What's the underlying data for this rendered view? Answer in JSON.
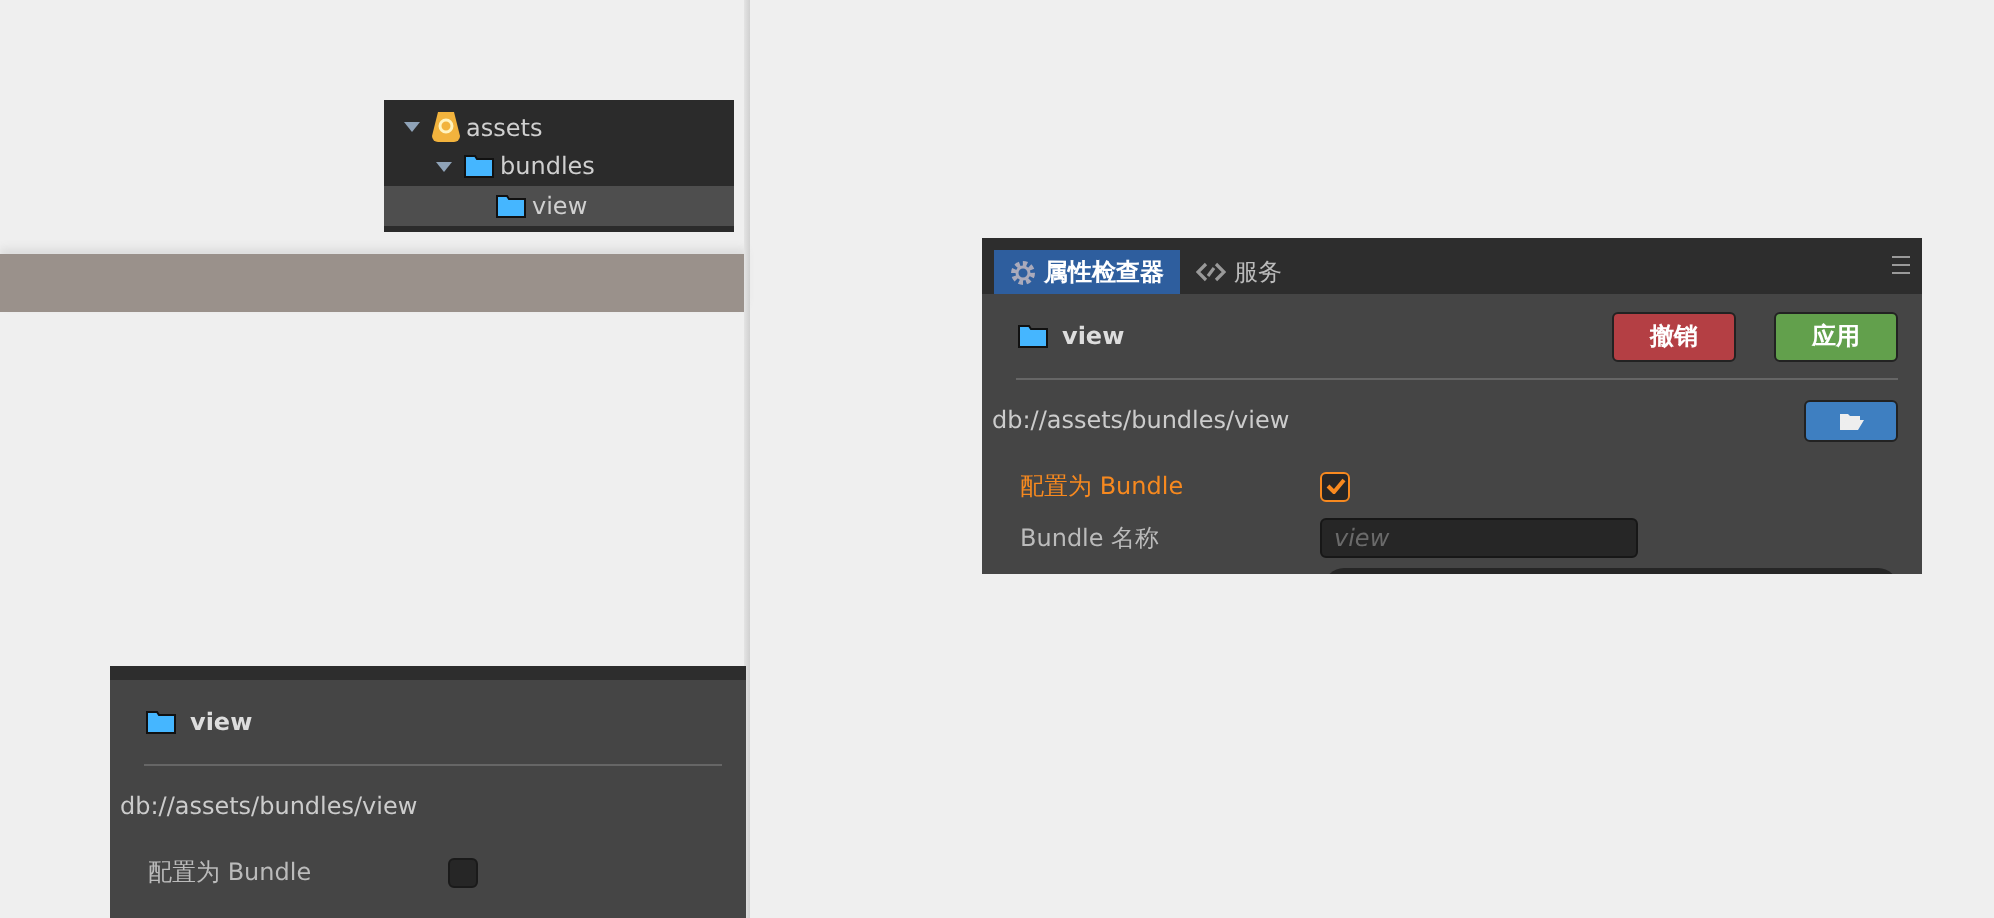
{
  "tree": [
    {
      "label": "assets",
      "kind": "root",
      "expanded": true,
      "selected": false,
      "children": [
        {
          "label": "bundles",
          "kind": "folder",
          "expanded": true,
          "selected": false,
          "children": [
            {
              "label": "view",
              "kind": "folder",
              "selected": true
            }
          ]
        }
      ]
    }
  ],
  "inspector": {
    "tabs": [
      {
        "label": "属性检查器",
        "kind": "inspector",
        "selected": true
      },
      {
        "label": "服务",
        "kind": "service",
        "selected": false
      }
    ],
    "asset": "view",
    "buttons": [
      {
        "label": "撤销",
        "kind": "revert"
      },
      {
        "label": "应用",
        "kind": "apply"
      }
    ],
    "path": "db://assets/bundles/view",
    "bundle_field": {
      "label": "配置为 Bundle",
      "checked": true,
      "modified": true
    },
    "name_field": {
      "label": "Bundle 名称",
      "placeholder": "view"
    }
  },
  "inspector_before": {
    "asset": "view",
    "path": "db://assets/bundles/view",
    "bundle_field": {
      "label": "配置为 Bundle",
      "checked": false,
      "modified": false
    }
  }
}
